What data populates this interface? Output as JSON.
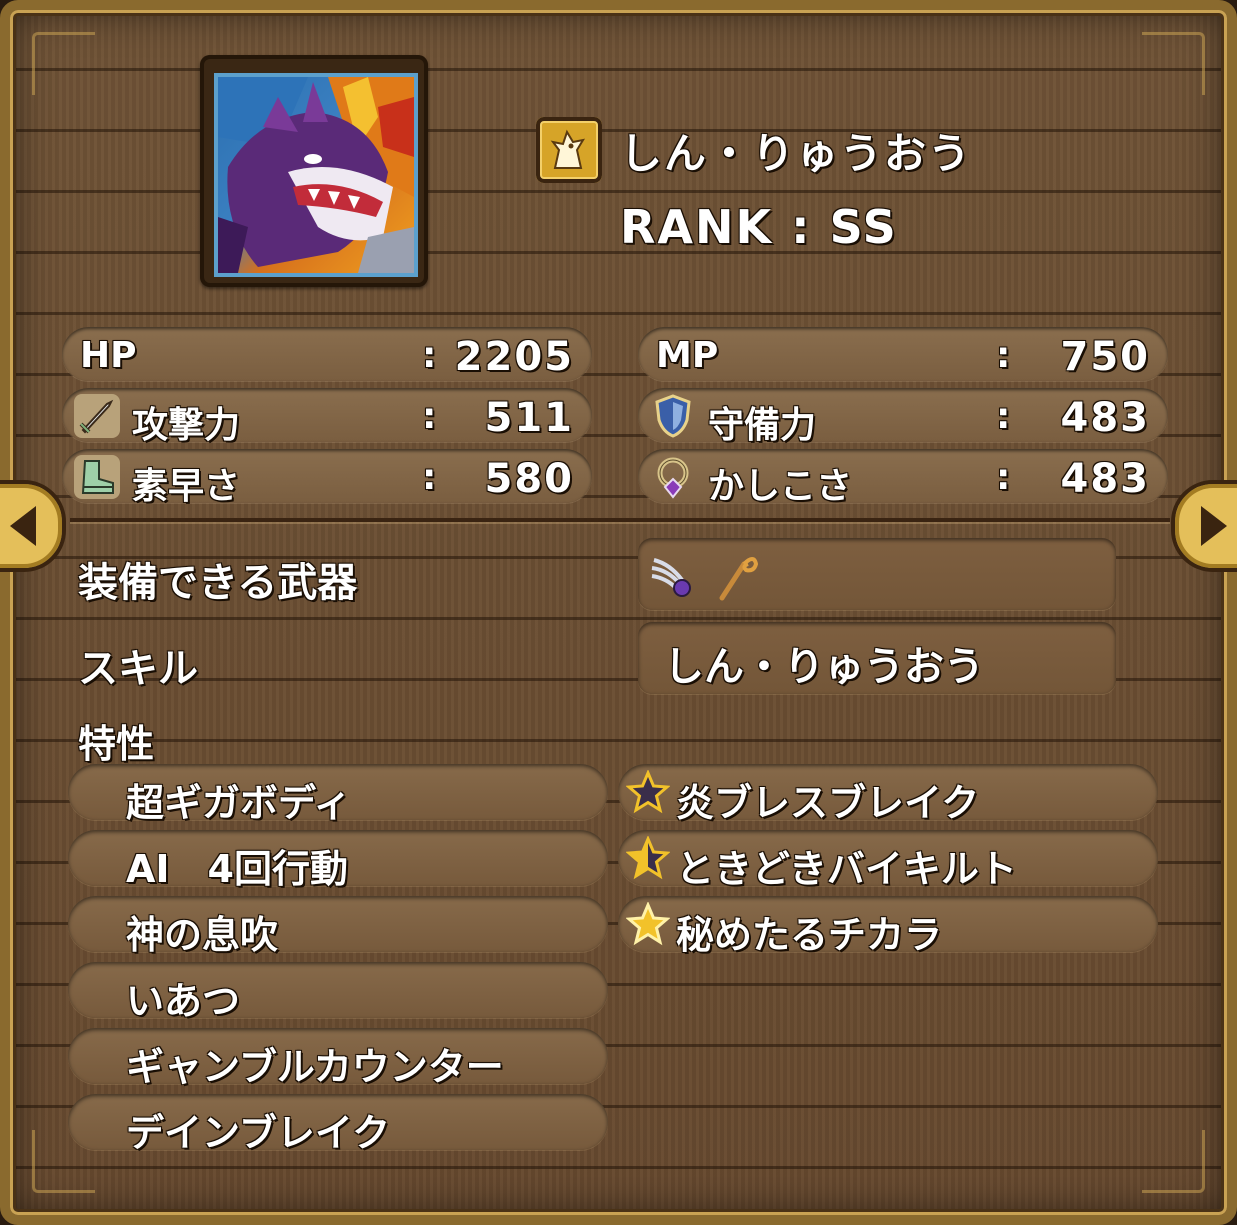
{
  "monster": {
    "name": "しん・りゅうおう",
    "rank_text": "RANK : SS",
    "class_icon": "dragon-class-icon",
    "portrait_icon": "dragon-portrait"
  },
  "stats": {
    "separator": ":",
    "hp": {
      "label": "HP",
      "value": "2205"
    },
    "mp": {
      "label": "MP",
      "value": "750"
    },
    "attack": {
      "label": "攻撃力",
      "value": "511",
      "icon": "sword-icon"
    },
    "defense": {
      "label": "守備力",
      "value": "483",
      "icon": "shield-icon"
    },
    "agility": {
      "label": "素早さ",
      "value": "580",
      "icon": "boot-icon"
    },
    "wisdom": {
      "label": "かしこさ",
      "value": "483",
      "icon": "ring-icon"
    }
  },
  "equipment": {
    "label": "装備できる武器",
    "weapons": [
      "claw-icon",
      "staff-icon"
    ]
  },
  "skill": {
    "label": "スキル",
    "value": "しん・りゅうおう"
  },
  "traits": {
    "label": "特性",
    "left": [
      "超ギガボディ",
      "AI　4回行動",
      "神の息吹",
      "いあつ",
      "ギャンブルカウンター",
      "デインブレイク"
    ],
    "right": [
      {
        "text": "炎ブレスブレイク",
        "star": "dark-star"
      },
      {
        "text": "ときどきバイキルト",
        "star": "half-star"
      },
      {
        "text": "秘めたるチカラ",
        "star": "gold-star"
      }
    ]
  },
  "colors": {
    "wood": "#6e5236",
    "frame_gold": "#c9a253",
    "text": "#ffffff",
    "star_gold": "#f2c22a"
  },
  "nav": {
    "prev_icon": "arrow-left-icon",
    "next_icon": "arrow-right-icon"
  }
}
